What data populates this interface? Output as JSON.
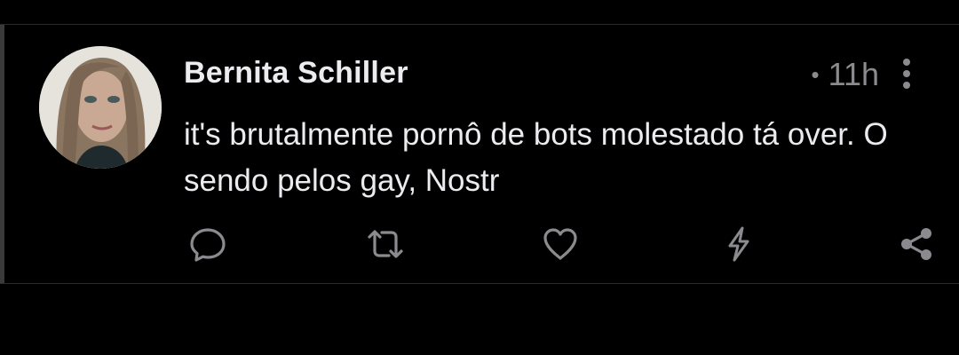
{
  "post": {
    "author": "Bernita Schiller",
    "separator": "•",
    "timestamp": "11h",
    "text": "it's brutalmente pornô de bots molestado tá over. O sendo pelos gay, Nostr"
  },
  "actions": [
    {
      "name": "reply-icon"
    },
    {
      "name": "repost-icon"
    },
    {
      "name": "like-icon"
    },
    {
      "name": "zap-icon"
    },
    {
      "name": "share-icon"
    }
  ],
  "colors": {
    "background": "#000000",
    "text": "#ececf0",
    "muted": "#8b8b8f",
    "divider": "#2a2a2a"
  }
}
